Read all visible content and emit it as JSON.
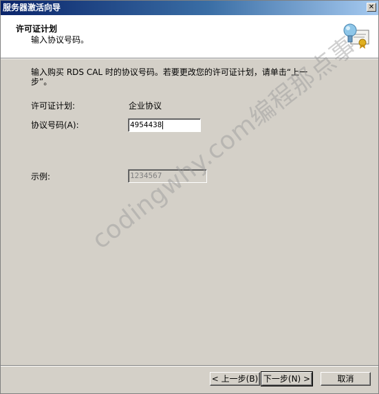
{
  "window": {
    "title": "服务器激活向导",
    "close_glyph": "✕"
  },
  "header": {
    "title": "许可证计划",
    "subtitle": "输入协议号码。",
    "icon": "certificate-icon"
  },
  "content": {
    "instruction": "输入购买 RDS CAL 时的协议号码。若要更改您的许可证计划，请单击“上一步”。",
    "license_plan_label": "许可证计划:",
    "license_plan_value": "企业协议",
    "agreement_number_label": "协议号码(A):",
    "agreement_number_value": "4954438",
    "example_label": "示例:",
    "example_value": "1234567"
  },
  "watermark": {
    "text": "codingwhy.com编程那点事"
  },
  "buttons": {
    "back": "< 上一步(B)",
    "next": "下一步(N) >",
    "cancel": "取消"
  },
  "colors": {
    "titlebar_start": "#0a246a",
    "titlebar_end": "#a6caf0",
    "dialog_bg": "#d4d0c8",
    "header_bg": "#ffffff"
  }
}
